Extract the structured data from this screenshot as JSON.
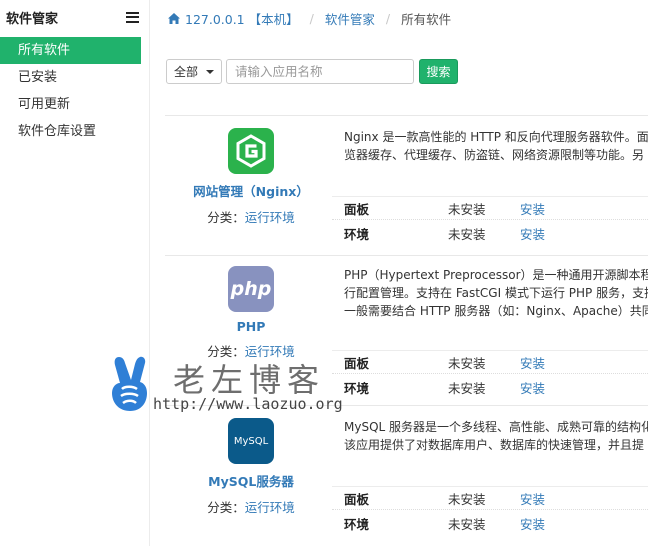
{
  "sidebar": {
    "title": "软件管家",
    "items": [
      {
        "label": "所有软件"
      },
      {
        "label": "已安装"
      },
      {
        "label": "可用更新"
      },
      {
        "label": "软件仓库设置"
      }
    ]
  },
  "breadcrumb": {
    "home": "127.0.0.1 【本机】",
    "section": "软件管家",
    "current": "所有软件"
  },
  "toolbar": {
    "filter_value": "全部",
    "search_placeholder": "请输入应用名称",
    "search_button": "搜索"
  },
  "software": [
    {
      "name": "网站管理（Nginx）",
      "category_label": "分类：",
      "category": "运行环境",
      "desc_line1": "Nginx 是一款高性能的 HTTP 和反向代理服务器软件。面",
      "desc_line2": "览器缓存、代理缓存、防盗链、网络资源限制等功能。另",
      "desc_line3": "",
      "panel_label": "面板",
      "panel_status": "未安装",
      "panel_action": "安装",
      "env_label": "环境",
      "env_status": "未安装",
      "env_action": "安装"
    },
    {
      "name": "PHP",
      "category_label": "分类：",
      "category": "运行环境",
      "desc_line1": "PHP（Hypertext Preprocessor）是一种通用开源脚本程序",
      "desc_line2": "行配置管理。支持在 FastCGI 模式下运行 PHP 服务，支持",
      "desc_line3": "一般需要结合 HTTP 服务器（如：Nginx、Apache）共同使",
      "panel_label": "面板",
      "panel_status": "未安装",
      "panel_action": "安装",
      "env_label": "环境",
      "env_status": "未安装",
      "env_action": "安装"
    },
    {
      "name": "MySQL服务器",
      "category_label": "分类：",
      "category": "运行环境",
      "desc_line1": "MySQL 服务器是一个多线程、高性能、成熟可靠的结构化",
      "desc_line2": "该应用提供了对数据库用户、数据库的快速管理，并且提",
      "desc_line3": "",
      "panel_label": "面板",
      "panel_status": "未安装",
      "panel_action": "安装",
      "env_label": "环境",
      "env_status": "未安装",
      "env_action": "安装"
    }
  ],
  "logos": {
    "nginx": {
      "text": "G",
      "color": "#2bb24c"
    },
    "php": {
      "text": "php",
      "color": "#8892bf"
    },
    "mysql": {
      "text": "MySQL",
      "color": "#0b5a8a"
    }
  },
  "watermark": {
    "text": "老左博客",
    "url": "http://www.laozuo.org"
  },
  "colors": {
    "accent": "#20b26c",
    "link": "#337ab7"
  }
}
